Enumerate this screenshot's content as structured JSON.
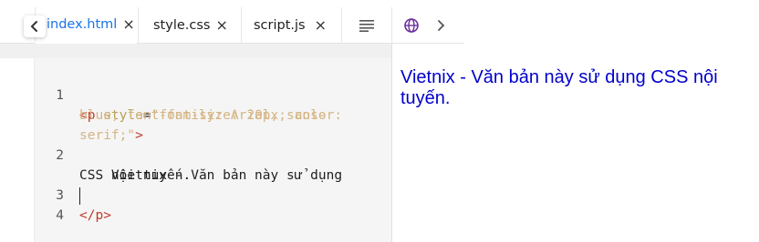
{
  "tabs": [
    {
      "label": "index.html",
      "active": true
    },
    {
      "label": "style.css",
      "active": false
    },
    {
      "label": "script.js",
      "active": false
    }
  ],
  "close_glyph": "×",
  "editor": {
    "line_numbers": [
      "1",
      "2",
      "3",
      "4"
    ],
    "line1_open": "<p ",
    "line1_attr": "style",
    "line1_eq": "=",
    "line1_str_a": "\"font-size: 20px; color:",
    "line1_str_b": "blue; font-family: Arial, sans-",
    "line1_str_c": "serif;\"",
    "line1_close": ">",
    "line2_a": "    Vietnix - Văn bản này sử dụng",
    "line2_b": "CSS nội tuyến.",
    "line3": "</p>"
  },
  "preview": {
    "text": "Vietnix - Văn bản này sử dụng CSS nội tuyến."
  },
  "colors": {
    "accent": "#1a73e8",
    "preview_text": "#0000cc",
    "tag": "#c0392b",
    "attr": "#b7a153",
    "string": "#d4b483"
  }
}
